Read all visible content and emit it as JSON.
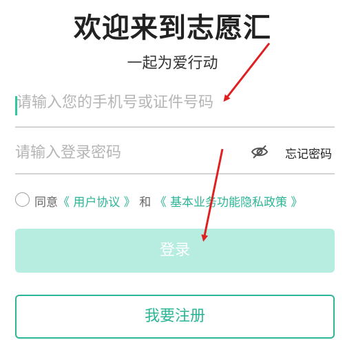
{
  "header": {
    "title": "欢迎来到志愿汇",
    "subtitle": "一起为爱行动"
  },
  "form": {
    "account_placeholder": "请输入您的手机号或证件号码",
    "password_placeholder": "请输入登录密码",
    "forgot_password": "忘记密码",
    "agreement": {
      "prefix": "同意",
      "user_agreement": "《 用户协议 》",
      "conjunction": "和",
      "privacy_policy": "《 基本业务功能隐私政策 》",
      "checked": false
    }
  },
  "buttons": {
    "login": "登录",
    "register": "我要注册"
  },
  "colors": {
    "accent": "#2cb596",
    "login_bg": "#b6ede0",
    "annotation_arrow": "#e02020"
  },
  "icons": {
    "password_visibility": "eye-off-icon"
  }
}
